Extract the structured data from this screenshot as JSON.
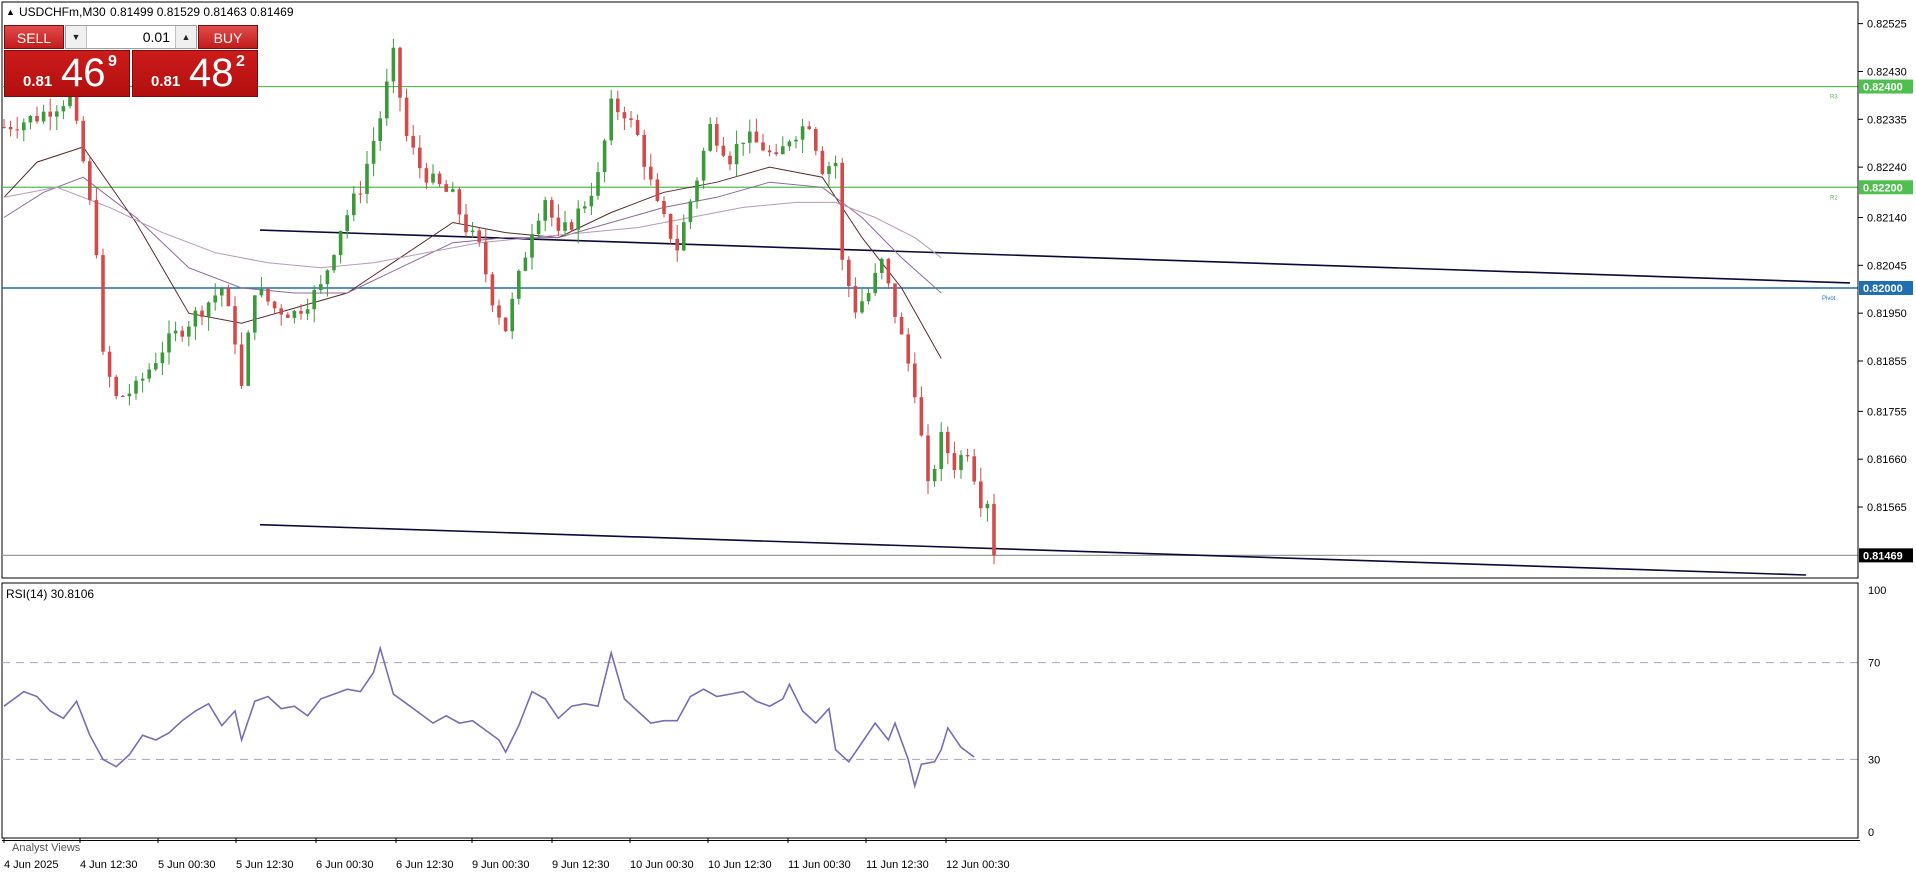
{
  "header": {
    "symbol": "USDCHFm,M30",
    "ohlc": "0.81499 0.81529 0.81463 0.81469"
  },
  "trade_panel": {
    "sell_label": "SELL",
    "buy_label": "BUY",
    "lot": "0.01",
    "sell_price_small": "0.81",
    "sell_price_big": "46",
    "sell_price_sup": "9",
    "buy_price_small": "0.81",
    "buy_price_big": "48",
    "buy_price_sup": "2"
  },
  "bottom_tab": "Analyst Views",
  "colors": {
    "bull": "#3a9a3a",
    "bear": "#d24a4a",
    "level_green": "#4fbf4f",
    "pivot_blue": "#1e6fb0",
    "trendline": "#0a0a3a",
    "rsi_line": "#7b6bb5",
    "grid": "#e6e6e6"
  },
  "chart_data": [
    {
      "type": "candlestick",
      "symbol": "USDCHFm",
      "timeframe": "M30",
      "y_ticks": [
        "0.82525",
        "0.82430",
        "0.82335",
        "0.82240",
        "0.82140",
        "0.82045",
        "0.81950",
        "0.81855",
        "0.81755",
        "0.81660",
        "0.81565"
      ],
      "ylim": [
        0.8143,
        0.8256
      ],
      "x_ticks": [
        "4 Jun 2025",
        "4 Jun 12:30",
        "5 Jun 00:30",
        "5 Jun 12:30",
        "6 Jun 00:30",
        "6 Jun 12:30",
        "9 Jun 00:30",
        "9 Jun 12:30",
        "10 Jun 00:30",
        "10 Jun 12:30",
        "11 Jun 00:30",
        "11 Jun 12:30",
        "12 Jun 00:30"
      ],
      "horizontal_levels": [
        {
          "value": 0.824,
          "label": "0.82400",
          "tag": "R3",
          "color": "green"
        },
        {
          "value": 0.822,
          "label": "0.82200",
          "tag": "R2",
          "color": "green"
        },
        {
          "value": 0.82,
          "label": "0.82000",
          "tag": "Pivot",
          "color": "blue"
        },
        {
          "value": 0.81469,
          "label": "0.81469",
          "tag": "",
          "color": "gray"
        }
      ],
      "trendlines": [
        {
          "from_index": 30,
          "from_value": 0.82115,
          "to_index": 218,
          "to_value": 0.8201
        },
        {
          "from_index": 30,
          "from_value": 0.8153,
          "to_index": 208,
          "to_value": 0.8143
        }
      ],
      "price_path": [
        [
          0,
          0.8232
        ],
        [
          5,
          0.8234
        ],
        [
          10,
          0.8238
        ],
        [
          12,
          0.8225
        ],
        [
          14,
          0.8208
        ],
        [
          15,
          0.8186
        ],
        [
          17,
          0.8178
        ],
        [
          20,
          0.818
        ],
        [
          24,
          0.8188
        ],
        [
          27,
          0.8192
        ],
        [
          30,
          0.8196
        ],
        [
          33,
          0.82
        ],
        [
          35,
          0.819
        ],
        [
          36,
          0.818
        ],
        [
          38,
          0.82
        ],
        [
          41,
          0.8196
        ],
        [
          44,
          0.8195
        ],
        [
          48,
          0.82
        ],
        [
          51,
          0.8212
        ],
        [
          54,
          0.822
        ],
        [
          57,
          0.8234
        ],
        [
          59,
          0.8246
        ],
        [
          61,
          0.823
        ],
        [
          63,
          0.8224
        ],
        [
          65,
          0.8221
        ],
        [
          68,
          0.8218
        ],
        [
          70,
          0.8212
        ],
        [
          72,
          0.8208
        ],
        [
          74,
          0.8198
        ],
        [
          76,
          0.8192
        ],
        [
          78,
          0.8202
        ],
        [
          80,
          0.8212
        ],
        [
          82,
          0.8218
        ],
        [
          84,
          0.821
        ],
        [
          86,
          0.8213
        ],
        [
          88,
          0.8217
        ],
        [
          90,
          0.8222
        ],
        [
          92,
          0.8236
        ],
        [
          94,
          0.8235
        ],
        [
          96,
          0.823
        ],
        [
          99,
          0.8216
        ],
        [
          102,
          0.8208
        ],
        [
          105,
          0.8222
        ],
        [
          107,
          0.8232
        ],
        [
          110,
          0.8226
        ],
        [
          112,
          0.823
        ],
        [
          115,
          0.8228
        ],
        [
          117,
          0.8225
        ],
        [
          119,
          0.823
        ],
        [
          122,
          0.8233
        ],
        [
          124,
          0.8224
        ],
        [
          126,
          0.8225
        ],
        [
          127,
          0.8205
        ],
        [
          129,
          0.8196
        ],
        [
          131,
          0.8199
        ],
        [
          133,
          0.8205
        ],
        [
          134,
          0.82
        ],
        [
          136,
          0.819
        ],
        [
          138,
          0.818
        ],
        [
          140,
          0.816
        ],
        [
          142,
          0.817
        ],
        [
          144,
          0.8165
        ],
        [
          146,
          0.8168
        ],
        [
          148,
          0.8158
        ],
        [
          149,
          0.8158
        ],
        [
          150,
          0.81469
        ]
      ],
      "moving_averages": [
        {
          "path": [
            [
              0,
              0.8218
            ],
            [
              5,
              0.8225
            ],
            [
              12,
              0.8228
            ],
            [
              20,
              0.8213
            ],
            [
              28,
              0.8195
            ],
            [
              36,
              0.8193
            ],
            [
              44,
              0.8196
            ],
            [
              52,
              0.8199
            ],
            [
              60,
              0.8206
            ],
            [
              68,
              0.8213
            ],
            [
              76,
              0.8211
            ],
            [
              84,
              0.821
            ],
            [
              92,
              0.8215
            ],
            [
              100,
              0.8219
            ],
            [
              108,
              0.8221
            ],
            [
              116,
              0.8224
            ],
            [
              124,
              0.8222
            ],
            [
              130,
              0.821
            ],
            [
              136,
              0.82
            ],
            [
              142,
              0.8186
            ]
          ]
        },
        {
          "path": [
            [
              0,
              0.8214
            ],
            [
              6,
              0.8219
            ],
            [
              12,
              0.8222
            ],
            [
              20,
              0.8214
            ],
            [
              28,
              0.8204
            ],
            [
              36,
              0.82
            ],
            [
              44,
              0.8199
            ],
            [
              52,
              0.8199
            ],
            [
              60,
              0.8204
            ],
            [
              68,
              0.8209
            ],
            [
              76,
              0.821
            ],
            [
              84,
              0.821
            ],
            [
              92,
              0.8213
            ],
            [
              100,
              0.8216
            ],
            [
              108,
              0.8218
            ],
            [
              116,
              0.8221
            ],
            [
              124,
              0.822
            ],
            [
              130,
              0.8214
            ],
            [
              136,
              0.8206
            ],
            [
              142,
              0.8199
            ]
          ]
        },
        {
          "path": [
            [
              0,
              0.8218
            ],
            [
              8,
              0.822
            ],
            [
              16,
              0.8216
            ],
            [
              24,
              0.8211
            ],
            [
              32,
              0.8207
            ],
            [
              40,
              0.8205
            ],
            [
              48,
              0.8204
            ],
            [
              56,
              0.8205
            ],
            [
              64,
              0.8207
            ],
            [
              72,
              0.8209
            ],
            [
              80,
              0.821
            ],
            [
              88,
              0.8211
            ],
            [
              96,
              0.8212
            ],
            [
              104,
              0.8214
            ],
            [
              112,
              0.8216
            ],
            [
              120,
              0.8217
            ],
            [
              126,
              0.8217
            ],
            [
              132,
              0.8214
            ],
            [
              138,
              0.821
            ],
            [
              142,
              0.8206
            ]
          ]
        }
      ]
    },
    {
      "type": "line",
      "title": "RSI(14) 30.8106",
      "y_ticks": [
        "100",
        "70",
        "30",
        "0"
      ],
      "ylim": [
        0,
        100
      ],
      "levels": [
        70,
        30
      ],
      "series": [
        {
          "name": "RSI(14)",
          "values": [
            [
              0,
              52
            ],
            [
              3,
              58
            ],
            [
              5,
              56
            ],
            [
              7,
              50
            ],
            [
              9,
              47
            ],
            [
              11,
              54
            ],
            [
              13,
              40
            ],
            [
              15,
              30
            ],
            [
              17,
              27
            ],
            [
              19,
              32
            ],
            [
              21,
              40
            ],
            [
              23,
              38
            ],
            [
              25,
              41
            ],
            [
              27,
              46
            ],
            [
              29,
              50
            ],
            [
              31,
              53
            ],
            [
              33,
              44
            ],
            [
              35,
              50
            ],
            [
              36,
              38
            ],
            [
              38,
              54
            ],
            [
              40,
              56
            ],
            [
              42,
              51
            ],
            [
              44,
              52
            ],
            [
              46,
              48
            ],
            [
              48,
              55
            ],
            [
              50,
              57
            ],
            [
              52,
              59
            ],
            [
              54,
              58
            ],
            [
              56,
              66
            ],
            [
              57,
              76
            ],
            [
              59,
              57
            ],
            [
              61,
              53
            ],
            [
              63,
              49
            ],
            [
              65,
              45
            ],
            [
              67,
              48
            ],
            [
              69,
              45
            ],
            [
              71,
              46
            ],
            [
              73,
              42
            ],
            [
              75,
              38
            ],
            [
              76,
              33
            ],
            [
              78,
              44
            ],
            [
              80,
              58
            ],
            [
              82,
              55
            ],
            [
              84,
              47
            ],
            [
              86,
              52
            ],
            [
              88,
              53
            ],
            [
              90,
              52
            ],
            [
              92,
              74
            ],
            [
              94,
              55
            ],
            [
              96,
              50
            ],
            [
              98,
              45
            ],
            [
              100,
              46
            ],
            [
              102,
              46
            ],
            [
              104,
              56
            ],
            [
              106,
              59
            ],
            [
              108,
              56
            ],
            [
              110,
              57
            ],
            [
              112,
              58
            ],
            [
              114,
              54
            ],
            [
              116,
              52
            ],
            [
              118,
              55
            ],
            [
              119,
              61
            ],
            [
              121,
              50
            ],
            [
              123,
              45
            ],
            [
              125,
              51
            ],
            [
              126,
              34
            ],
            [
              128,
              29
            ],
            [
              130,
              37
            ],
            [
              132,
              45
            ],
            [
              134,
              38
            ],
            [
              135,
              45
            ],
            [
              137,
              30
            ],
            [
              138,
              19
            ],
            [
              139,
              28
            ],
            [
              141,
              29
            ],
            [
              142,
              34
            ],
            [
              143,
              43
            ],
            [
              145,
              35
            ],
            [
              147,
              31
            ]
          ]
        }
      ]
    }
  ]
}
